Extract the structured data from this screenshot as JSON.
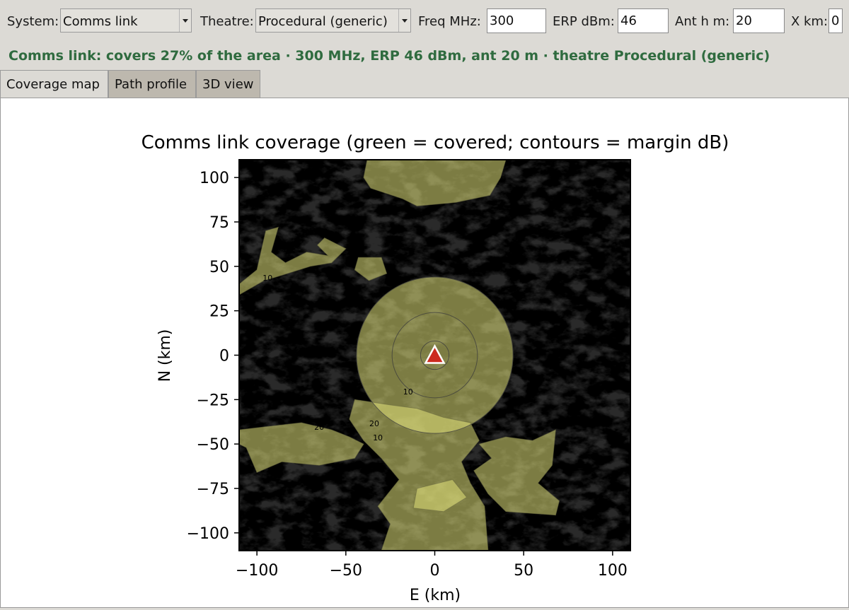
{
  "toolbar": {
    "system_label": "System:",
    "system_value": "Comms link",
    "theatre_label": "Theatre:",
    "theatre_value": "Procedural (generic)",
    "freq_label": "Freq MHz:",
    "freq_value": "300",
    "erp_label": "ERP dBm:",
    "erp_value": "46",
    "ant_label": "Ant h m:",
    "ant_value": "20",
    "x_label": "X km:",
    "x_value": "0"
  },
  "status": {
    "text": "Comms link: covers 27% of the area  ·  300 MHz, ERP 46 dBm, ant 20 m  ·  theatre Procedural (generic)"
  },
  "tabs": [
    "Coverage map",
    "Path profile",
    "3D view"
  ],
  "active_tab": 0,
  "chart_data": {
    "type": "heatmap",
    "title": "Comms link coverage (green = covered; contours = margin dB)",
    "xlabel": "E (km)",
    "ylabel": "N (km)",
    "xlim": [
      -110,
      110
    ],
    "ylim": [
      -110,
      110
    ],
    "xticks": [
      -100,
      -50,
      0,
      50,
      100
    ],
    "yticks": [
      -100,
      -75,
      -50,
      -25,
      0,
      25,
      50,
      75,
      100
    ],
    "xtick_labels": [
      "−100",
      "−50",
      "0",
      "50",
      "100"
    ],
    "ytick_labels": [
      "−100",
      "−75",
      "−50",
      "−25",
      "0",
      "25",
      "50",
      "75",
      "100"
    ],
    "coverage_fraction": 0.27,
    "transmitter": {
      "x": 0,
      "y": 0
    },
    "contour_labels": [
      "10",
      "10",
      "10",
      "10",
      "20",
      "20"
    ],
    "colors": {
      "covered": "#e2e27a",
      "terrain_dark": "#2a2a2a",
      "terrain_light": "#c8c8c8",
      "transmitter": "#cc2a1f"
    }
  }
}
